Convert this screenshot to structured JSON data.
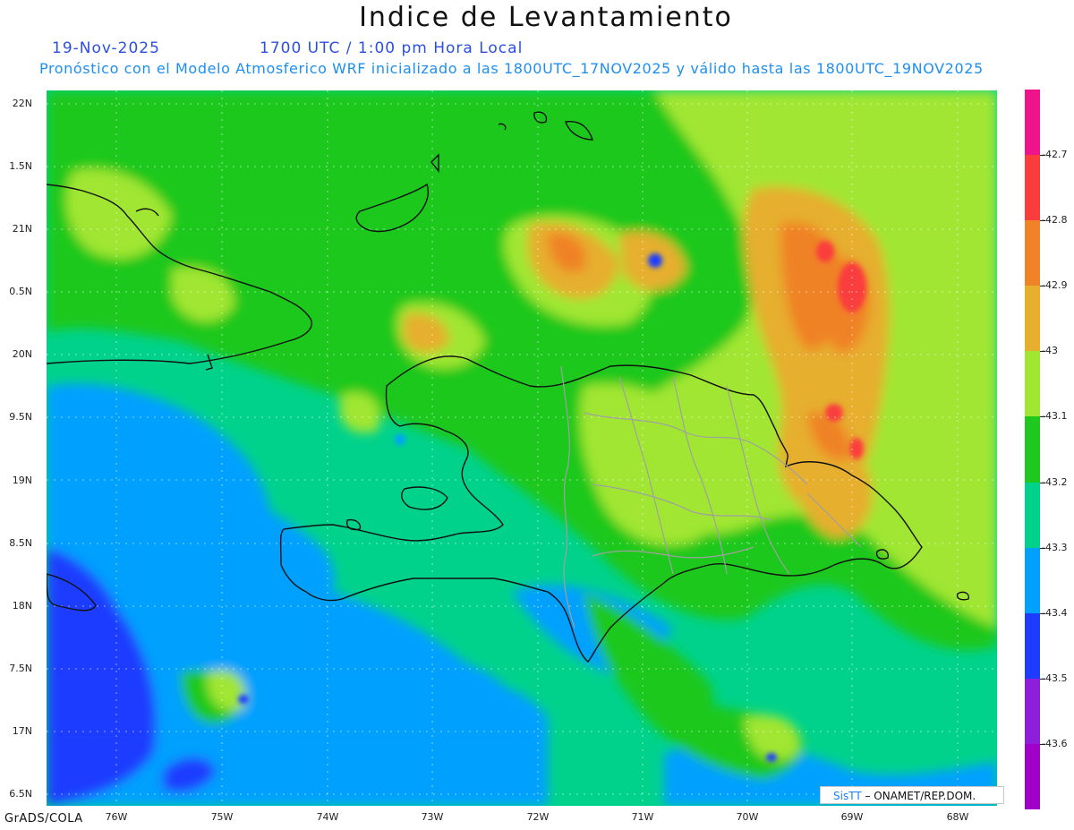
{
  "title": "Indice de Levantamiento",
  "date": "19-Nov-2025",
  "valid_time": "1700 UTC / 1:00 pm Hora Local",
  "subtitle": "Pronóstico con el Modelo Atmosferico WRF inicializado a las 1800UTC_17NOV2025 y válido hasta las  1800UTC_19NOV2025",
  "footer": "GrADS/COLA",
  "credit": {
    "brand": "SisTT",
    "text": "– ONAMET/REP.DOM."
  },
  "map": {
    "lat_labels": [
      "22N",
      "1.5N",
      "21N",
      "0.5N",
      "20N",
      "9.5N",
      "19N",
      "8.5N",
      "18N",
      "7.5N",
      "17N",
      "6.5N"
    ],
    "lon_labels": [
      "76W",
      "75W",
      "74W",
      "73W",
      "72W",
      "71W",
      "70W",
      "69W",
      "68W"
    ]
  },
  "colorbar": {
    "labels": [
      "-42.7",
      "-42.8",
      "-42.9",
      "-43",
      "-43.1",
      "-43.2",
      "-43.3",
      "-43.4",
      "-43.5",
      "-43.6"
    ],
    "colors": [
      "#f0148c",
      "#fa3c3c",
      "#f08228",
      "#e6af2d",
      "#a0e632",
      "#1ec81e",
      "#00d28c",
      "#00a0ff",
      "#1e3cff",
      "#8c1edc",
      "#a000c8"
    ]
  },
  "palette": {
    "dark_blue": "#1e3cff",
    "blue": "#00a0ff",
    "teal": "#00d28c",
    "green": "#1ec81e",
    "light_green": "#a0e632",
    "gold": "#e6af2d",
    "orange": "#f08228",
    "red": "#fa3c3c"
  }
}
